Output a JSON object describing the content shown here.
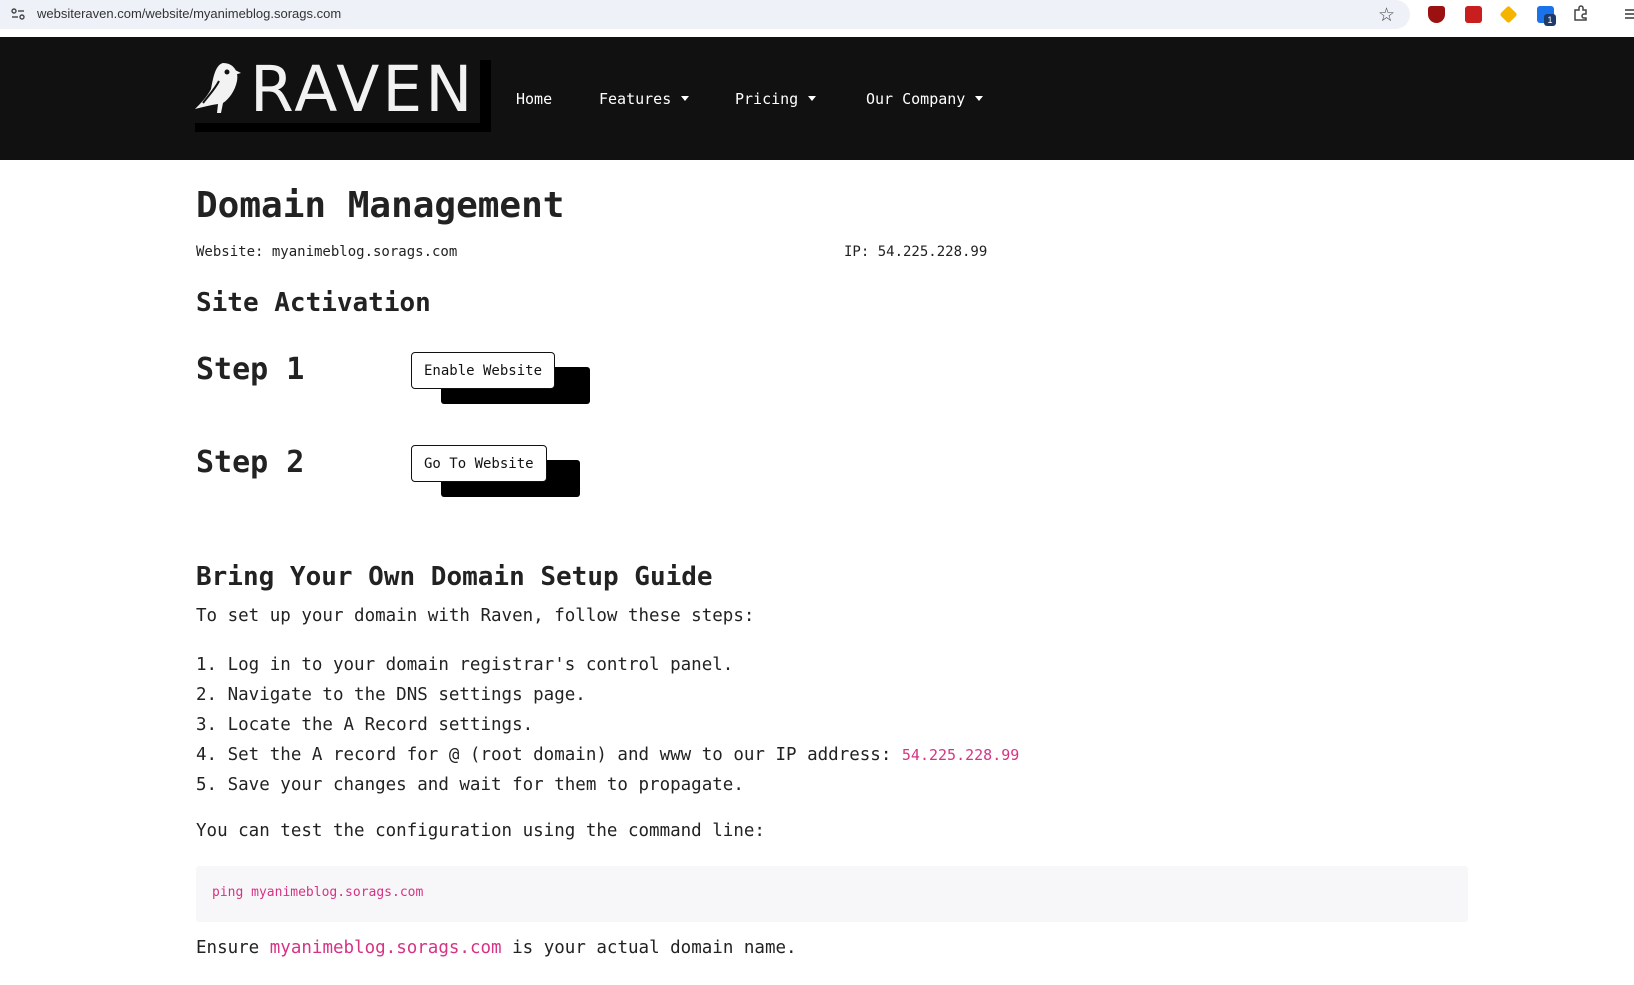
{
  "browser": {
    "url": "websiteraven.com/website/myanimeblog.sorags.com",
    "ext_badge": "1"
  },
  "header": {
    "logo_text": "RAVEN",
    "nav": {
      "home": "Home",
      "features": "Features",
      "pricing": "Pricing",
      "company": "Our Company"
    }
  },
  "page": {
    "title": "Domain Management",
    "website_line": "Website: myanimeblog.sorags.com",
    "ip_line": "IP: 54.225.228.99",
    "activation_title": "Site Activation",
    "step1_label": "Step 1",
    "step1_button": "Enable Website",
    "step2_label": "Step 2",
    "step2_button": "Go To Website"
  },
  "guide": {
    "title": "Bring Your Own Domain Setup Guide",
    "intro": "To set up your domain with Raven, follow these steps:",
    "steps": [
      "1. Log in to your domain registrar's control panel.",
      "2. Navigate to the DNS settings page.",
      "3. Locate the A Record settings.",
      "4. Set the A record for @ (root domain) and www to our IP address: ",
      "5. Save your changes and wait for them to propagate."
    ],
    "ip_highlight": "54.225.228.99",
    "test_line": "You can test the configuration using the command line:",
    "command": "ping myanimeblog.sorags.com",
    "ensure_prefix": "Ensure ",
    "ensure_domain": "myanimeblog.sorags.com",
    "ensure_suffix": " is your actual domain name."
  },
  "colors": {
    "header_bg": "#111111",
    "accent_pink": "#d63384",
    "code_bg": "#f7f7f9"
  }
}
